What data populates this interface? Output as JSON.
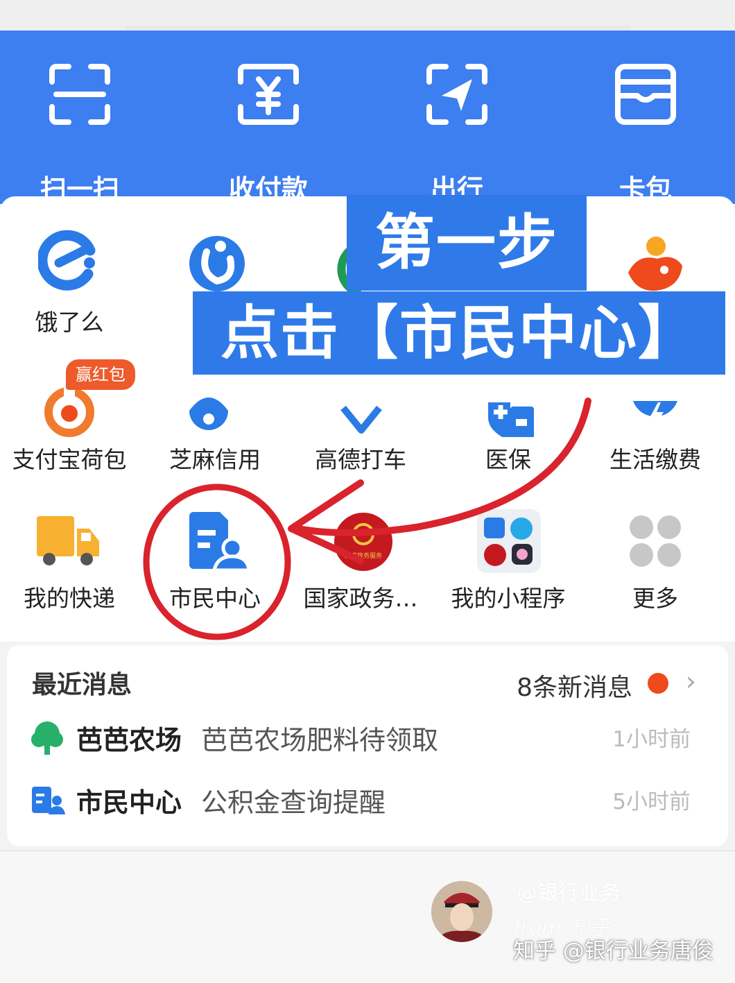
{
  "header": {
    "items": [
      {
        "label": "扫一扫",
        "icon": "scan-icon"
      },
      {
        "label": "收付款",
        "icon": "yuan-payment-icon"
      },
      {
        "label": "出行",
        "icon": "travel-arrow-icon"
      },
      {
        "label": "卡包",
        "icon": "wallet-icon"
      }
    ]
  },
  "overlay": {
    "step": "第一步",
    "instruction": "点击【市民中心】"
  },
  "grid": {
    "row1": [
      {
        "label": "饿了么",
        "icon": "eleme-icon"
      },
      {
        "label": "",
        "icon": "blue-circle-app-icon"
      },
      {
        "label": "",
        "icon": "green-circle-app-icon"
      },
      {
        "label": "",
        "icon": ""
      },
      {
        "label": "",
        "icon": "orange-fish-app-icon"
      }
    ],
    "row2": [
      {
        "label": "支付宝荷包",
        "icon": "hebao-icon",
        "badge": "赢红包"
      },
      {
        "label": "芝麻信用",
        "icon": "sesame-credit-icon"
      },
      {
        "label": "高德打车",
        "icon": "amap-taxi-icon"
      },
      {
        "label": "医保",
        "icon": "medical-insurance-icon"
      },
      {
        "label": "生活缴费",
        "icon": "utility-bill-icon"
      }
    ],
    "row3": [
      {
        "label": "我的快递",
        "icon": "delivery-truck-icon"
      },
      {
        "label": "市民中心",
        "icon": "citizen-center-icon"
      },
      {
        "label": "国家政务…",
        "icon": "national-gov-service-icon",
        "icon_text": "国家政务服务"
      },
      {
        "label": "我的小程序",
        "icon": "mini-programs-icon"
      },
      {
        "label": "更多",
        "icon": "more-dots-icon"
      }
    ]
  },
  "messages": {
    "title": "最近消息",
    "count": "8条新消息",
    "items": [
      {
        "source": "芭芭农场",
        "text": "芭芭农场肥料待领取",
        "time": "1小时前",
        "icon": "tree-icon"
      },
      {
        "source": "市民中心",
        "text": "公积金查询提醒",
        "time": "5小时前",
        "icon": "citizen-center-small-icon"
      }
    ]
  },
  "footer": {
    "watermark_top": "@银行业务",
    "watermark_from": "from 知乎",
    "watermark": "知乎 @银行业务唐俊"
  },
  "colors": {
    "header_blue": "#3d7ef0",
    "overlay_blue": "#2f7ae8",
    "annotation_red": "#d9232d",
    "badge_orange": "#ee5a2c"
  }
}
